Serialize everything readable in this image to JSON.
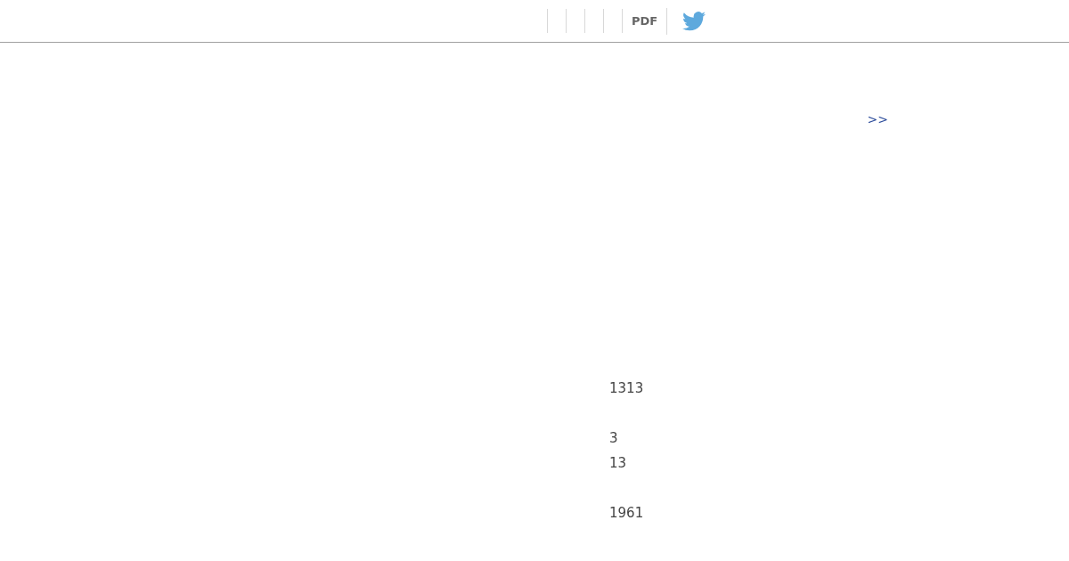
{
  "toolbar": {
    "pdf_label": "PDF"
  },
  "next_link": ">>",
  "values": [
    [
      "1313"
    ],
    [
      "3",
      "13"
    ],
    [
      "1961"
    ]
  ]
}
